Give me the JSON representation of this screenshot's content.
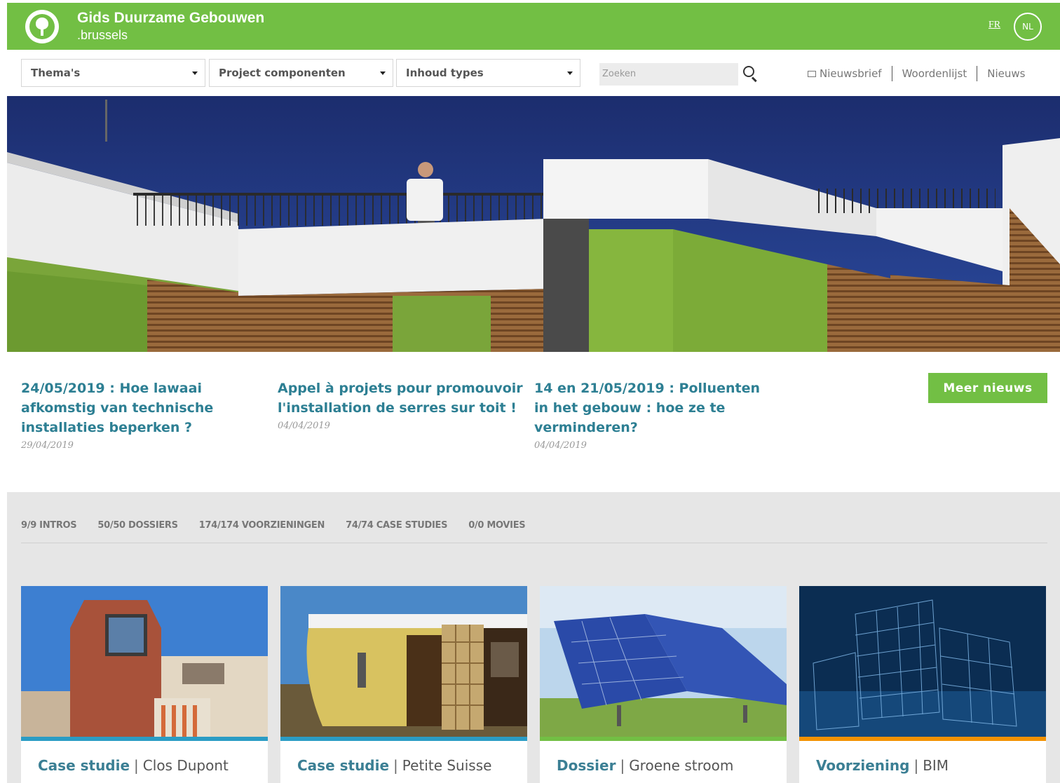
{
  "header": {
    "title": "Gids Duurzame Gebouwen",
    "subtitle": ".brussels",
    "lang_fr": "FR",
    "lang_nl": "NL",
    "brand_color": "#72bf44"
  },
  "nav": {
    "dropdowns": [
      "Thema's",
      "Project componenten",
      "Inhoud types"
    ],
    "search_placeholder": "Zoeken",
    "links": [
      "Nieuwsbrief",
      "Woordenlijst",
      "Nieuws"
    ]
  },
  "news": [
    {
      "title": "24/05/2019 : Hoe lawaai afkomstig van technische installaties beperken ?",
      "date": "29/04/2019"
    },
    {
      "title": "Appel à projets pour promouvoir l'installation de serres sur toit !",
      "date": "04/04/2019"
    },
    {
      "title": "14 en 21/05/2019 : Polluenten in het gebouw : hoe ze te verminderen?",
      "date": "04/04/2019"
    }
  ],
  "more_news_label": "Meer nieuws",
  "filters": [
    "9/9 INTROS",
    "50/50 DOSSIERS",
    "174/174 VOORZIENINGEN",
    "74/74 CASE STUDIES",
    "0/0 MOVIES"
  ],
  "cards": [
    {
      "type": "Case studie",
      "name": "Clos Dupont",
      "accent": "#2b9cc4"
    },
    {
      "type": "Case studie",
      "name": "Petite Suisse",
      "accent": "#2b9cc4"
    },
    {
      "type": "Dossier",
      "name": "Groene stroom",
      "accent": "#72bf44"
    },
    {
      "type": "Voorziening",
      "name": "BIM",
      "accent": "#f39200"
    }
  ]
}
